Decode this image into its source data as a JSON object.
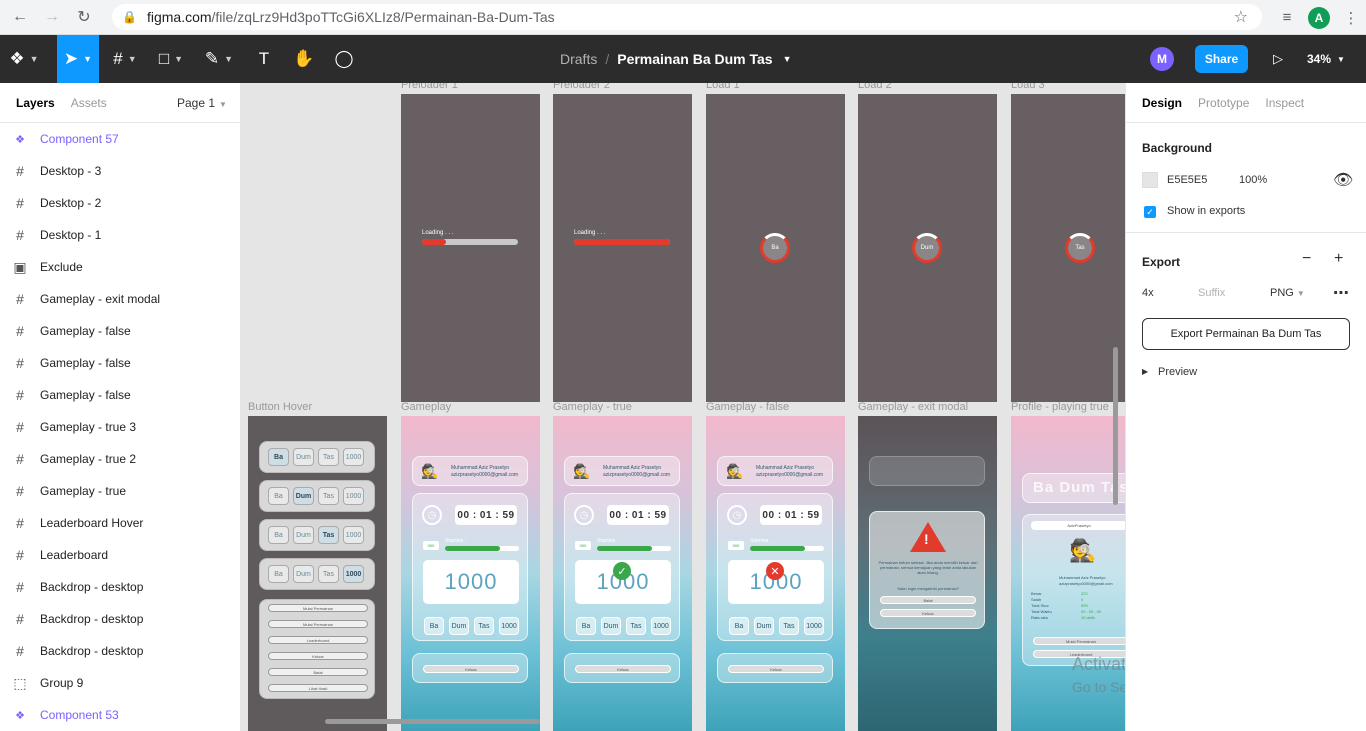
{
  "browser": {
    "url_host": "figma.com",
    "url_path": "/file/zqLrz9Hd3poTTcGi6XLIz8/Permainan-Ba-Dum-Tas",
    "profile_initial": "A"
  },
  "toolbar": {
    "drafts": "Drafts",
    "separator": "/",
    "file_name": "Permainan Ba Dum Tas",
    "user_initial": "M",
    "share_label": "Share",
    "zoom": "34%"
  },
  "layers_panel": {
    "tab_layers": "Layers",
    "tab_assets": "Assets",
    "page": "Page 1",
    "items": [
      {
        "label": "Component 57",
        "icon": "component-icon"
      },
      {
        "label": "Desktop - 3",
        "icon": "frame-icon"
      },
      {
        "label": "Desktop - 2",
        "icon": "frame-icon"
      },
      {
        "label": "Desktop - 1",
        "icon": "frame-icon"
      },
      {
        "label": "Exclude",
        "icon": "boolean-icon"
      },
      {
        "label": "Gameplay - exit modal",
        "icon": "frame-icon"
      },
      {
        "label": "Gameplay - false",
        "icon": "frame-icon"
      },
      {
        "label": "Gameplay - false",
        "icon": "frame-icon"
      },
      {
        "label": "Gameplay - false",
        "icon": "frame-icon"
      },
      {
        "label": "Gameplay - true 3",
        "icon": "frame-icon"
      },
      {
        "label": "Gameplay - true 2",
        "icon": "frame-icon"
      },
      {
        "label": "Gameplay - true",
        "icon": "frame-icon"
      },
      {
        "label": "Leaderboard Hover",
        "icon": "frame-icon"
      },
      {
        "label": "Leaderboard",
        "icon": "frame-icon"
      },
      {
        "label": "Backdrop - desktop",
        "icon": "frame-icon"
      },
      {
        "label": "Backdrop - desktop",
        "icon": "frame-icon"
      },
      {
        "label": "Backdrop - desktop",
        "icon": "frame-icon"
      },
      {
        "label": "Group 9",
        "icon": "group-icon"
      },
      {
        "label": "Component 53",
        "icon": "component-icon"
      }
    ]
  },
  "canvas": {
    "frame_labels": {
      "preloader1": "Preloader 1",
      "preloader2": "Preloader 2",
      "load1": "Load 1",
      "load2": "Load 2",
      "load3": "Load 3",
      "button_hover": "Button Hover",
      "gameplay": "Gameplay",
      "gameplay_true": "Gameplay - true",
      "gameplay_false": "Gameplay - false",
      "gameplay_exit": "Gameplay - exit modal",
      "profile": "Profile - playing true"
    },
    "loading_text": "Loading . . .",
    "preloader1_progress": 0.25,
    "preloader2_progress": 1.0,
    "spinner_words": [
      "Ba",
      "Dum",
      "Tas"
    ],
    "player_name": "Muhammad Aziz Prasetyo",
    "player_email": "azizprasetyo0000@gmail.com",
    "timer": "00 : 01 : 59",
    "stamina_label": "Stamina :",
    "stamina_value": "000",
    "score": "1000",
    "buttons": [
      "Ba",
      "Dum",
      "Tas",
      "1000"
    ],
    "exit_button": "Keluar",
    "modal_text": "Permainan belum selesai. Jika anda memilih keluar dari permainan, semua kemajuan yang telah anda lakukan akan hilang.",
    "modal_question": "Yakin ingin mengakhiri permainan?",
    "modal_confirm": "Batal",
    "modal_exit": "Keluar",
    "hover_menu": [
      "Mulai Permainan",
      "Mulai Permainan",
      "Leaderboard",
      "Keluar",
      "Batal",
      "Lihat Hasil"
    ],
    "profile_title": "Ba Dum Tas",
    "profile_username": "AzizPrasetyo",
    "profile_stats": [
      {
        "k": "Benar",
        "v": "222"
      },
      {
        "k": "Salah",
        "v": "0"
      },
      {
        "k": "Total Skor",
        "v": "999"
      },
      {
        "k": "Total Waktu",
        "v": "00 : 09 : 00"
      },
      {
        "k": "Rata-rata",
        "v": "10 detik"
      }
    ],
    "profile_buttons": [
      "Mulai Permainan",
      "Leaderboard"
    ]
  },
  "watermark": {
    "line1": "Activate Windows",
    "line2": "Go to Settings to activate Windows."
  },
  "help_label": "?",
  "design_panel": {
    "tab_design": "Design",
    "tab_prototype": "Prototype",
    "tab_inspect": "Inspect",
    "background_title": "Background",
    "bg_hex": "E5E5E5",
    "bg_opacity": "100%",
    "show_in_exports": "Show in exports",
    "export_title": "Export",
    "export_scale": "4x",
    "export_suffix_placeholder": "Suffix",
    "export_format": "PNG",
    "export_button": "Export Permainan Ba Dum Tas",
    "preview": "Preview"
  },
  "colors": {
    "figma_blue": "#0d99ff",
    "toolbar_bg": "#2c2c2c",
    "component_purple": "#7b61ff",
    "canvas_bg": "#e5e5e5",
    "loader_red": "#e23a2c"
  }
}
